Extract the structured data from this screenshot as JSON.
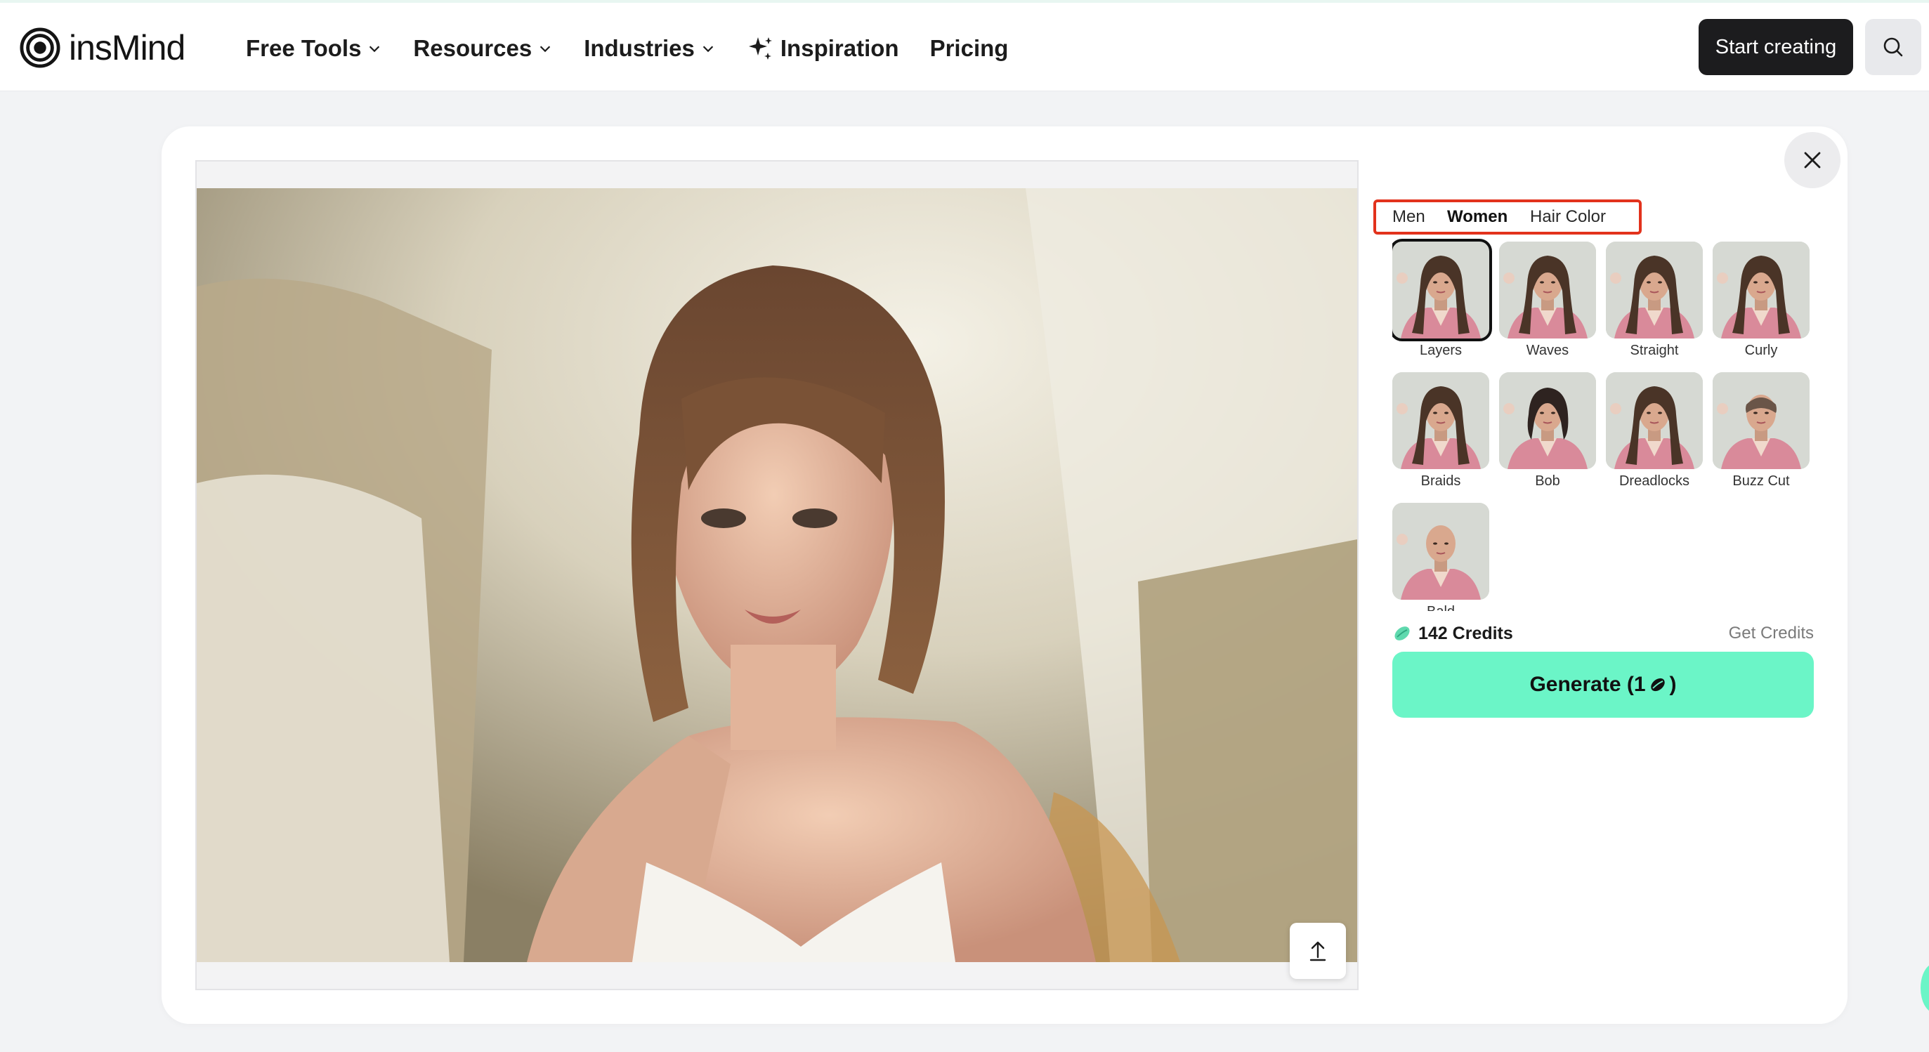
{
  "brand": {
    "name": "insMind"
  },
  "nav": {
    "items": [
      {
        "label": "Free Tools",
        "dropdown": true
      },
      {
        "label": "Resources",
        "dropdown": true
      },
      {
        "label": "Industries",
        "dropdown": true
      },
      {
        "label": "Inspiration",
        "dropdown": false,
        "icon": "sparkle-icon"
      },
      {
        "label": "Pricing",
        "dropdown": false
      }
    ]
  },
  "header": {
    "start_label": "Start creating",
    "search_icon": "search-icon"
  },
  "modal": {
    "close_icon": "close-icon",
    "upload_icon": "upload-icon",
    "tabs": [
      {
        "label": "Men",
        "active": false
      },
      {
        "label": "Women",
        "active": true
      },
      {
        "label": "Hair Color",
        "active": false
      }
    ],
    "styles": [
      {
        "label": "Layers",
        "selected": true,
        "hair": "long"
      },
      {
        "label": "Waves",
        "selected": false,
        "hair": "long"
      },
      {
        "label": "Straight",
        "selected": false,
        "hair": "long"
      },
      {
        "label": "Curly",
        "selected": false,
        "hair": "long"
      },
      {
        "label": "Braids",
        "selected": false,
        "hair": "long"
      },
      {
        "label": "Bob",
        "selected": false,
        "hair": "bob"
      },
      {
        "label": "Dreadlocks",
        "selected": false,
        "hair": "long"
      },
      {
        "label": "Buzz Cut",
        "selected": false,
        "hair": "buzz"
      },
      {
        "label": "Bald",
        "selected": false,
        "hair": "bald"
      }
    ],
    "credits": {
      "amount": "142 Credits",
      "get_label": "Get Credits"
    },
    "generate": {
      "prefix": "Generate (1",
      "suffix": ")"
    }
  },
  "colors": {
    "accent": "#6bf5c7",
    "highlight_box": "#e2321c",
    "dark_button": "#1c1c1e"
  }
}
